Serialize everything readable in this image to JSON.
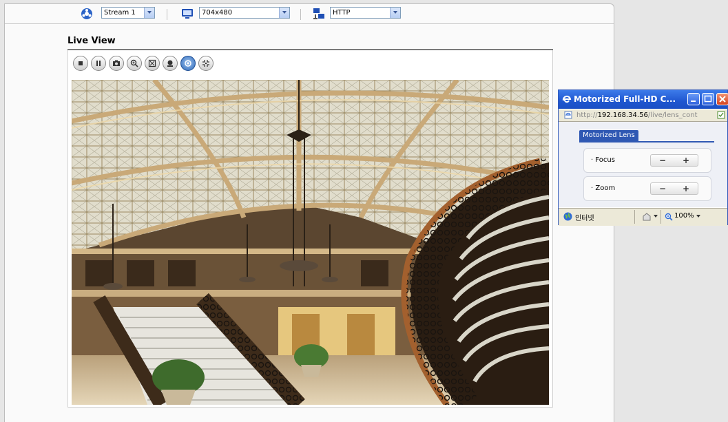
{
  "toolbar": {
    "stream_value": "Stream 1",
    "resolution_value": "704x480",
    "protocol_value": "HTTP"
  },
  "live_view": {
    "title": "Live View",
    "controls": [
      "stop-icon",
      "pause-icon",
      "snapshot-icon",
      "zoom-in-icon",
      "fullscreen-icon",
      "record-icon",
      "lens-control-icon",
      "fit-screen-icon"
    ]
  },
  "popup": {
    "title": "Motorized Full-HD C...",
    "url_prefix": "http://",
    "url_host": "192.168.34.56",
    "url_path": "/live/lens_cont",
    "tab_label": "Motorized Lens",
    "focus_label": "· Focus",
    "zoom_label": "· Zoom",
    "minus": "−",
    "plus": "+",
    "status_zone": "인터넷",
    "zoom_level": "100%"
  },
  "colors": {
    "accent": "#2f58b3",
    "titlebar": "#1f56d0",
    "active_control": "#2a66b8"
  }
}
